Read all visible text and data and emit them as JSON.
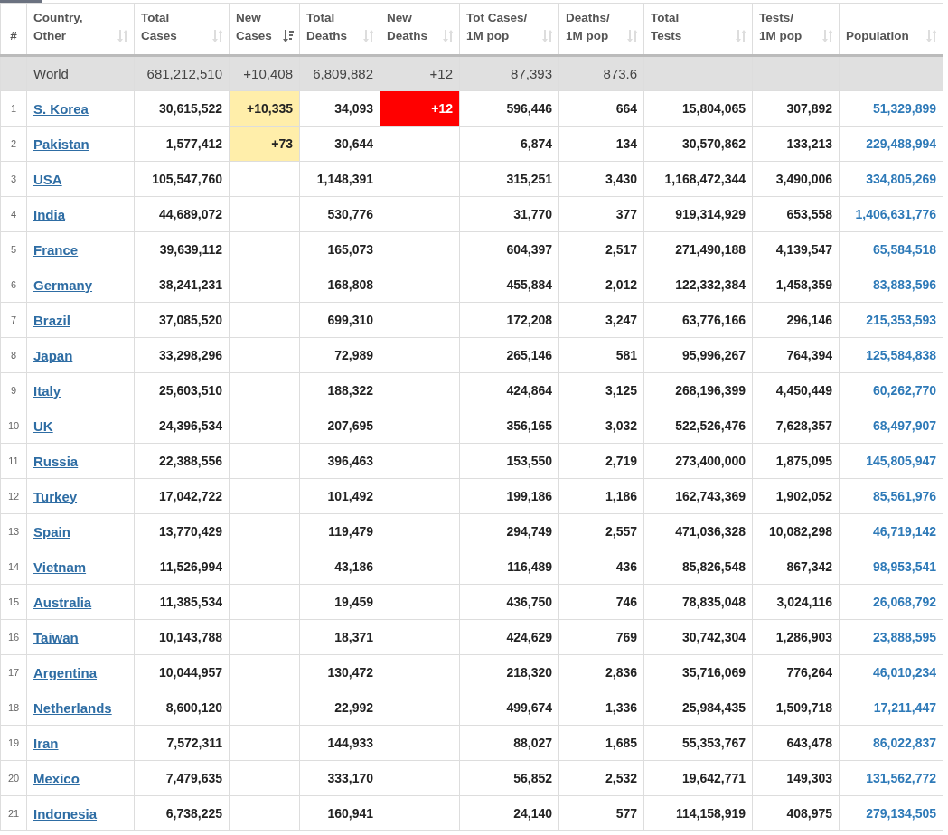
{
  "columns": [
    {
      "lines": [
        "#"
      ]
    },
    {
      "lines": [
        "Country,",
        "Other"
      ],
      "sorted": false
    },
    {
      "lines": [
        "Total",
        "Cases"
      ],
      "sorted": false
    },
    {
      "lines": [
        "New",
        "Cases"
      ],
      "sorted": true
    },
    {
      "lines": [
        "Total",
        "Deaths"
      ],
      "sorted": false
    },
    {
      "lines": [
        "New",
        "Deaths"
      ],
      "sorted": false
    },
    {
      "lines": [
        "Tot Cases/",
        "1M pop"
      ],
      "sorted": false
    },
    {
      "lines": [
        "Deaths/",
        "1M pop"
      ],
      "sorted": false
    },
    {
      "lines": [
        "Total",
        "Tests"
      ],
      "sorted": false
    },
    {
      "lines": [
        "Tests/",
        "1M pop"
      ],
      "sorted": false
    },
    {
      "lines": [
        "Population"
      ],
      "sorted": false
    }
  ],
  "world_row": {
    "country": "World",
    "total_cases": "681,212,510",
    "new_cases": "+10,408",
    "total_deaths": "6,809,882",
    "new_deaths": "+12",
    "cases_1m": "87,393",
    "deaths_1m": "873.6"
  },
  "rows": [
    {
      "rank": "1",
      "country": "S. Korea",
      "total_cases": "30,615,522",
      "new_cases": "+10,335",
      "total_deaths": "34,093",
      "new_deaths": "+12",
      "cases_1m": "596,446",
      "deaths_1m": "664",
      "total_tests": "15,804,065",
      "tests_1m": "307,892",
      "population": "51,329,899"
    },
    {
      "rank": "2",
      "country": "Pakistan",
      "total_cases": "1,577,412",
      "new_cases": "+73",
      "total_deaths": "30,644",
      "cases_1m": "6,874",
      "deaths_1m": "134",
      "total_tests": "30,570,862",
      "tests_1m": "133,213",
      "population": "229,488,994"
    },
    {
      "rank": "3",
      "country": "USA",
      "total_cases": "105,547,760",
      "total_deaths": "1,148,391",
      "cases_1m": "315,251",
      "deaths_1m": "3,430",
      "total_tests": "1,168,472,344",
      "tests_1m": "3,490,006",
      "population": "334,805,269"
    },
    {
      "rank": "4",
      "country": "India",
      "total_cases": "44,689,072",
      "total_deaths": "530,776",
      "cases_1m": "31,770",
      "deaths_1m": "377",
      "total_tests": "919,314,929",
      "tests_1m": "653,558",
      "population": "1,406,631,776"
    },
    {
      "rank": "5",
      "country": "France",
      "total_cases": "39,639,112",
      "total_deaths": "165,073",
      "cases_1m": "604,397",
      "deaths_1m": "2,517",
      "total_tests": "271,490,188",
      "tests_1m": "4,139,547",
      "population": "65,584,518"
    },
    {
      "rank": "6",
      "country": "Germany",
      "total_cases": "38,241,231",
      "total_deaths": "168,808",
      "cases_1m": "455,884",
      "deaths_1m": "2,012",
      "total_tests": "122,332,384",
      "tests_1m": "1,458,359",
      "population": "83,883,596"
    },
    {
      "rank": "7",
      "country": "Brazil",
      "total_cases": "37,085,520",
      "total_deaths": "699,310",
      "cases_1m": "172,208",
      "deaths_1m": "3,247",
      "total_tests": "63,776,166",
      "tests_1m": "296,146",
      "population": "215,353,593"
    },
    {
      "rank": "8",
      "country": "Japan",
      "total_cases": "33,298,296",
      "total_deaths": "72,989",
      "cases_1m": "265,146",
      "deaths_1m": "581",
      "total_tests": "95,996,267",
      "tests_1m": "764,394",
      "population": "125,584,838"
    },
    {
      "rank": "9",
      "country": "Italy",
      "total_cases": "25,603,510",
      "total_deaths": "188,322",
      "cases_1m": "424,864",
      "deaths_1m": "3,125",
      "total_tests": "268,196,399",
      "tests_1m": "4,450,449",
      "population": "60,262,770"
    },
    {
      "rank": "10",
      "country": "UK",
      "total_cases": "24,396,534",
      "total_deaths": "207,695",
      "cases_1m": "356,165",
      "deaths_1m": "3,032",
      "total_tests": "522,526,476",
      "tests_1m": "7,628,357",
      "population": "68,497,907"
    },
    {
      "rank": "11",
      "country": "Russia",
      "total_cases": "22,388,556",
      "total_deaths": "396,463",
      "cases_1m": "153,550",
      "deaths_1m": "2,719",
      "total_tests": "273,400,000",
      "tests_1m": "1,875,095",
      "population": "145,805,947"
    },
    {
      "rank": "12",
      "country": "Turkey",
      "total_cases": "17,042,722",
      "total_deaths": "101,492",
      "cases_1m": "199,186",
      "deaths_1m": "1,186",
      "total_tests": "162,743,369",
      "tests_1m": "1,902,052",
      "population": "85,561,976"
    },
    {
      "rank": "13",
      "country": "Spain",
      "total_cases": "13,770,429",
      "total_deaths": "119,479",
      "cases_1m": "294,749",
      "deaths_1m": "2,557",
      "total_tests": "471,036,328",
      "tests_1m": "10,082,298",
      "population": "46,719,142"
    },
    {
      "rank": "14",
      "country": "Vietnam",
      "total_cases": "11,526,994",
      "total_deaths": "43,186",
      "cases_1m": "116,489",
      "deaths_1m": "436",
      "total_tests": "85,826,548",
      "tests_1m": "867,342",
      "population": "98,953,541"
    },
    {
      "rank": "15",
      "country": "Australia",
      "total_cases": "11,385,534",
      "total_deaths": "19,459",
      "cases_1m": "436,750",
      "deaths_1m": "746",
      "total_tests": "78,835,048",
      "tests_1m": "3,024,116",
      "population": "26,068,792"
    },
    {
      "rank": "16",
      "country": "Taiwan",
      "total_cases": "10,143,788",
      "total_deaths": "18,371",
      "cases_1m": "424,629",
      "deaths_1m": "769",
      "total_tests": "30,742,304",
      "tests_1m": "1,286,903",
      "population": "23,888,595"
    },
    {
      "rank": "17",
      "country": "Argentina",
      "total_cases": "10,044,957",
      "total_deaths": "130,472",
      "cases_1m": "218,320",
      "deaths_1m": "2,836",
      "total_tests": "35,716,069",
      "tests_1m": "776,264",
      "population": "46,010,234"
    },
    {
      "rank": "18",
      "country": "Netherlands",
      "total_cases": "8,600,120",
      "total_deaths": "22,992",
      "cases_1m": "499,674",
      "deaths_1m": "1,336",
      "total_tests": "25,984,435",
      "tests_1m": "1,509,718",
      "population": "17,211,447"
    },
    {
      "rank": "19",
      "country": "Iran",
      "total_cases": "7,572,311",
      "total_deaths": "144,933",
      "cases_1m": "88,027",
      "deaths_1m": "1,685",
      "total_tests": "55,353,767",
      "tests_1m": "643,478",
      "population": "86,022,837"
    },
    {
      "rank": "20",
      "country": "Mexico",
      "total_cases": "7,479,635",
      "total_deaths": "333,170",
      "cases_1m": "56,852",
      "deaths_1m": "2,532",
      "total_tests": "19,642,771",
      "tests_1m": "149,303",
      "population": "131,562,772"
    },
    {
      "rank": "21",
      "country": "Indonesia",
      "total_cases": "6,738,225",
      "total_deaths": "160,941",
      "cases_1m": "24,140",
      "deaths_1m": "577",
      "total_tests": "114,158,919",
      "tests_1m": "408,975",
      "population": "279,134,505"
    }
  ]
}
